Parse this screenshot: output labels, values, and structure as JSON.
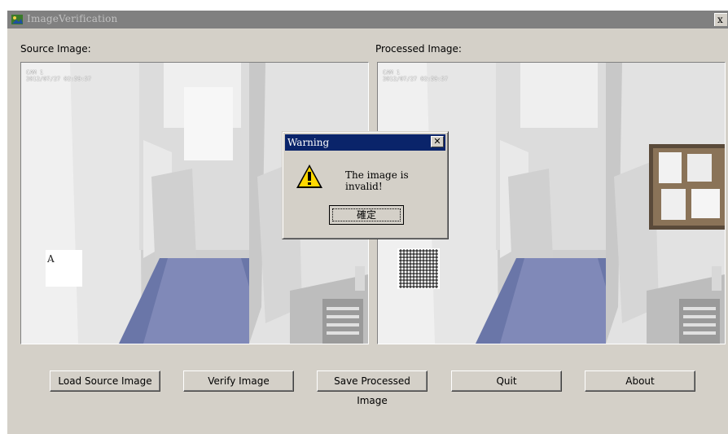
{
  "window": {
    "title": "ImageVerification",
    "close_glyph": "x"
  },
  "labels": {
    "source": "Source Image:",
    "processed": "Processed Image:"
  },
  "source_image": {
    "stamp": "CAM 1\n2012/07/27 02:59:57",
    "watermark_text": "A"
  },
  "processed_image": {
    "stamp": "CAM 1\n2012/07/27 02:59:57"
  },
  "buttons": {
    "load": "Load Source Image",
    "verify": "Verify Image",
    "save": "Save Processed Image",
    "quit": "Quit",
    "about": "About"
  },
  "dialog": {
    "title": "Warning",
    "close_glyph": "✕",
    "message": "The image is invalid!",
    "ok": "確定",
    "icon": "warning-icon"
  },
  "colors": {
    "face": "#d4d0c8",
    "dialog_title": "#0a246a",
    "inactive_title": "#808080"
  }
}
